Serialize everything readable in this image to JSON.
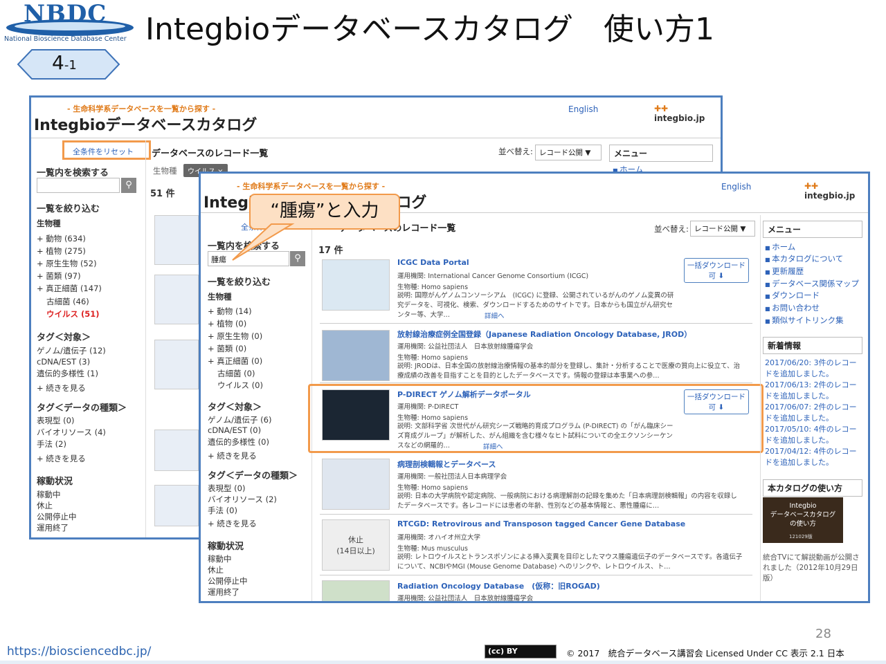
{
  "slide": {
    "logo": "NBDC",
    "logo_sub": "National Bioscience Database Center",
    "title": "Integbioデータベースカタログ　使い方1",
    "badge": "4",
    "badge_sub": "-1",
    "url": "https://biosciencedbc.jp/",
    "page": "28",
    "cc": "(cc) BY",
    "copyright": "© 2017　統合データベース講習会 Licensed Under CC 表示 2.1 日本",
    "callout": "“腫瘍”と入力"
  },
  "w1": {
    "tag": "- 生命科学系データベースを一覧から探す -",
    "site_title": "Integbioデータベースカタログ",
    "english": "English",
    "brand": "integbio.jp",
    "reset": "全条件をリセット",
    "record_heading": "データベースのレコード一覧",
    "sort_label": "並べ替え:",
    "sort_value": "レコード公開 ▼",
    "menu": "メニュー",
    "menu_home": "ホーム",
    "search_heading": "一覧内を検索する",
    "filter_heading": "一覧を絞り込む",
    "organism_heading": "生物種",
    "organisms": [
      "+ 動物 (634)",
      "+ 植物 (275)",
      "+ 原生生物 (52)",
      "+ 菌類 (97)",
      "+ 真正細菌 (147)",
      "古細菌 (46)",
      "ウイルス (51)"
    ],
    "filter_label": "生物種",
    "filter_chip": "ウイルス ×",
    "count": "51 件",
    "tag_target_heading": "タグ＜対象＞",
    "tag_targets": [
      "ゲノム/遺伝子 (12)",
      "cDNA/EST (3)",
      "遺伝的多様性 (1)",
      "+ 続きを見る"
    ],
    "tag_type_heading": "タグ＜データの種類＞",
    "tag_types": [
      "表現型 (0)",
      "バイオリソース (4)",
      "手法 (2)",
      "+ 続きを見る"
    ],
    "status_heading": "稼動状況",
    "statuses": [
      "稼動中",
      "休止",
      "公開停止中",
      "運用終了"
    ]
  },
  "w2": {
    "tag": "- 生命科学系データベースを一覧から探す -",
    "site_title": "Integbioデータベースカタログ",
    "english": "English",
    "brand": "integbio.jp",
    "reset": "全条件",
    "record_heading": "データベースのレコード一覧",
    "sort_label": "並べ替え:",
    "sort_value": "レコード公開 ▼",
    "search_heading": "一覧内を検索する",
    "search_value": "腫瘍",
    "filter_heading": "一覧を絞り込む",
    "organism_heading": "生物種",
    "organisms": [
      "+ 動物 (14)",
      "+ 植物 (0)",
      "+ 原生生物 (0)",
      "+ 菌類 (0)",
      "+ 真正細菌 (0)",
      "古細菌 (0)",
      "ウイルス (0)"
    ],
    "tag_target_heading": "タグ＜対象＞",
    "tag_targets": [
      "ゲノム/遺伝子 (6)",
      "cDNA/EST (0)",
      "遺伝的多様性 (0)",
      "+ 続きを見る"
    ],
    "tag_type_heading": "タグ＜データの種類＞",
    "tag_types": [
      "表現型 (0)",
      "バイオリソース (2)",
      "手法 (0)",
      "+ 続きを見る"
    ],
    "status_heading": "稼動状況",
    "statuses": [
      "稼動中",
      "休止",
      "公開停止中",
      "運用終了"
    ],
    "count": "17 件",
    "download": "一括ダウンロード",
    "download2": "可 ⬇",
    "records": [
      {
        "title": "ICGC Data Portal",
        "m1": "運用機関: International Cancer Genome Consortium (ICGC)",
        "m2": "生物種: Homo sapiens",
        "d": "説明: 国際がんゲノムコンソーシアム　(ICGC) に登録、公開されているがんのゲノム変異の研究データを、可視化、検索、ダウンロードするためのサイトです。日本からも国立がん研究センター等、大学…",
        "more": "詳細へ"
      },
      {
        "title": "放射線治療症例全国登録（Japanese Radiation Oncology Database, JROD）",
        "m1": "運用機関: 公益社団法人　日本放射線腫瘍学会",
        "m2": "生物種: Homo sapiens",
        "d": "説明: JRODは、日本全国の放射線治療情報の基本的部分を登録し、集計・分析することで医療の質向上に役立て、治療成績の改善を目指すことを目的としたデータベースです。情報の登録は本事業への参…",
        "more": "詳細へ"
      },
      {
        "title": "P-DIRECT ゲノム解析データポータル",
        "m1": "運用機関: P-DIRECT",
        "m2": "生物種: Homo sapiens",
        "d": "説明: 文部科学省 次世代がん研究シーズ戦略的育成プログラム (P-DIRECT) の「がん臨床シーズ育成グループ」が解析した、がん組織を含む様々なヒト試料についての全エクソンシーケンスなどの網羅的…",
        "more": "詳細へ"
      },
      {
        "title": "病理剖検輯報とデータベース",
        "m1": "運用機関: 一般社団法人日本病理学会",
        "m2": "生物種: Homo sapiens",
        "d": "説明: 日本の大学病院や認定病院、一般病院における病理解剖の記録を集めた「日本病理剖検輯報」の内容を収録したデータベースです。各レコードには患者の年齢、性別などの基本情報と、悪性腫瘍に…",
        "more": "詳細へ"
      },
      {
        "title": "RTCGD: Retrovirous and Transposon tagged Cancer Gene Database",
        "m1": "運用機関: オハイオ州立大学",
        "m2": "生物種: Mus musculus",
        "d": "説明: レトロウイルスとトランスポゾンによる挿入変異を目印としたマウス腫瘍遺伝子のデータベースです。各遺伝子について、NCBIやMGI (Mouse Genome Database) へのリンクや、レトロウイルス、ト…",
        "more": "詳細へ"
      },
      {
        "title": "Radiation Oncology Database　(仮称：旧ROGAD)",
        "m1": "運用機関: 公益社団法人　日本放射線腫瘍学会",
        "m2": "",
        "d": "",
        "more": ""
      }
    ],
    "thumb_pause": "休止\n(14日以上)",
    "menu": "メニュー",
    "menu_items": [
      "ホーム",
      "本カタログについて",
      "更新履歴",
      "データベース関係マップ",
      "ダウンロード",
      "お問い合わせ",
      "類似サイトリンク集"
    ],
    "news_heading": "新着情報",
    "news": [
      "2017/06/20: 3件のレコードを追加しました。",
      "2017/06/13: 2件のレコードを追加しました。",
      "2017/06/07: 2件のレコードを追加しました。",
      "2017/05/10: 4件のレコードを追加しました。",
      "2017/04/12: 4件のレコードを追加しました。"
    ],
    "howto_heading": "本カタログの使い方",
    "video_text": "Integbio\nデータベースカタログ\nの使い方",
    "video_sub": "121029版",
    "howto_desc": "統合TVにて解説動画が公開されました（2012年10月29日 版）"
  }
}
